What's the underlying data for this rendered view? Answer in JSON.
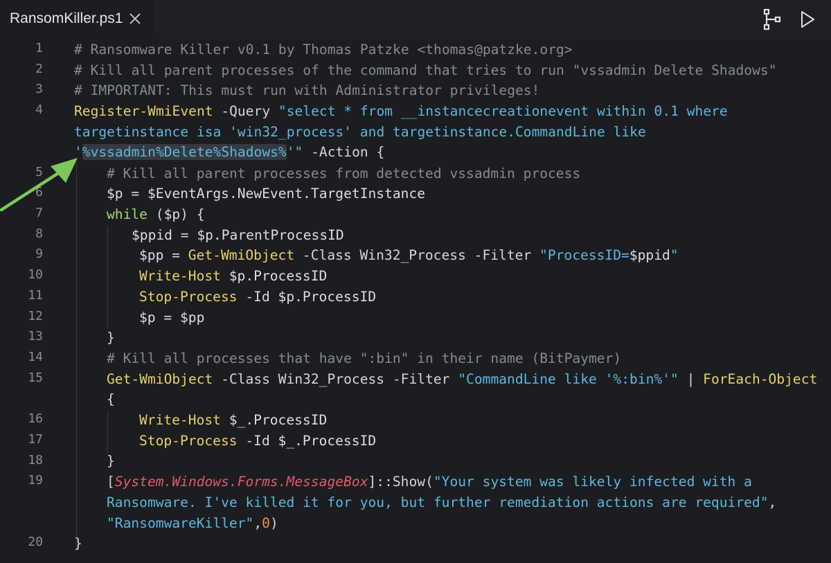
{
  "tab": {
    "filename": "RansomKiller.ps1"
  },
  "toolbar": {
    "split_icon": "split-editor-icon",
    "run_icon": "run-play-icon"
  },
  "colors": {
    "comment": "#878a90",
    "command": "#e8d267",
    "parameter": "#d4d6da",
    "string": "#5cb8e0",
    "keyword": "#a7da70",
    "type": "#e25a6b",
    "number": "#f49246",
    "arrow": "#7dc85a"
  },
  "lines": [
    {
      "num": "1",
      "parts": [
        "# Ransomware Killer v0.1 by Thomas Patzke <thomas@patzke.org>"
      ]
    },
    {
      "num": "2",
      "parts": [
        "# Kill all parent processes of the command that tries to run \"vssadmin Delete Shadows\""
      ]
    },
    {
      "num": "3",
      "parts": [
        "# IMPORTANT: This must run with Administrator privileges!"
      ]
    },
    {
      "num": "4",
      "parts": [
        "Register-WmiEvent",
        " -Query ",
        "\"select * from __instancecreationevent within 0.1 where",
        "targetinstance isa 'win32_process' and targetinstance.CommandLine like",
        "'",
        "%vssadmin%Delete%Shadows%",
        "'\"",
        " -Action {"
      ]
    },
    {
      "num": "5",
      "parts": [
        "# Kill all parent processes from detected vssadmin process"
      ]
    },
    {
      "num": "6",
      "parts": [
        "$p",
        " = ",
        "$EventArgs.NewEvent.TargetInstance"
      ]
    },
    {
      "num": "7",
      "parts": [
        "while",
        " (",
        "$p",
        ") {"
      ]
    },
    {
      "num": "8",
      "parts": [
        "$ppid",
        " = ",
        "$p.ParentProcessID"
      ]
    },
    {
      "num": "9",
      "parts": [
        "$pp",
        " = ",
        "Get-WmiObject",
        " -Class Win32_Process -Filter ",
        "\"ProcessID=",
        "$ppid",
        "\""
      ]
    },
    {
      "num": "10",
      "parts": [
        "Write-Host",
        " ",
        "$p.ProcessID"
      ]
    },
    {
      "num": "11",
      "parts": [
        "Stop-Process",
        " -Id ",
        "$p.ProcessID"
      ]
    },
    {
      "num": "12",
      "parts": [
        "$p",
        " = ",
        "$pp"
      ]
    },
    {
      "num": "13",
      "parts": [
        "}"
      ]
    },
    {
      "num": "14",
      "parts": [
        "# Kill all processes that have \":bin\" in their name (BitPaymer)"
      ]
    },
    {
      "num": "15",
      "parts": [
        "Get-WmiObject",
        " -Class Win32_Process -Filter ",
        "\"CommandLine like '%:bin%'\"",
        " | ",
        "ForEach-Object",
        "{"
      ]
    },
    {
      "num": "16",
      "parts": [
        "Write-Host",
        " ",
        "$_.ProcessID"
      ]
    },
    {
      "num": "17",
      "parts": [
        "Stop-Process",
        " -Id ",
        "$_.ProcessID"
      ]
    },
    {
      "num": "18",
      "parts": [
        "}"
      ]
    },
    {
      "num": "19",
      "parts": [
        "[",
        "System.Windows.Forms.MessageBox",
        "]::Show(",
        "\"Your system was likely infected with a",
        "Ransomware. I've killed it for you, but further remediation actions are required\"",
        ",",
        "\"RansomwareKiller\"",
        ",",
        "0",
        ")"
      ]
    },
    {
      "num": "20",
      "parts": [
        "}"
      ]
    }
  ]
}
